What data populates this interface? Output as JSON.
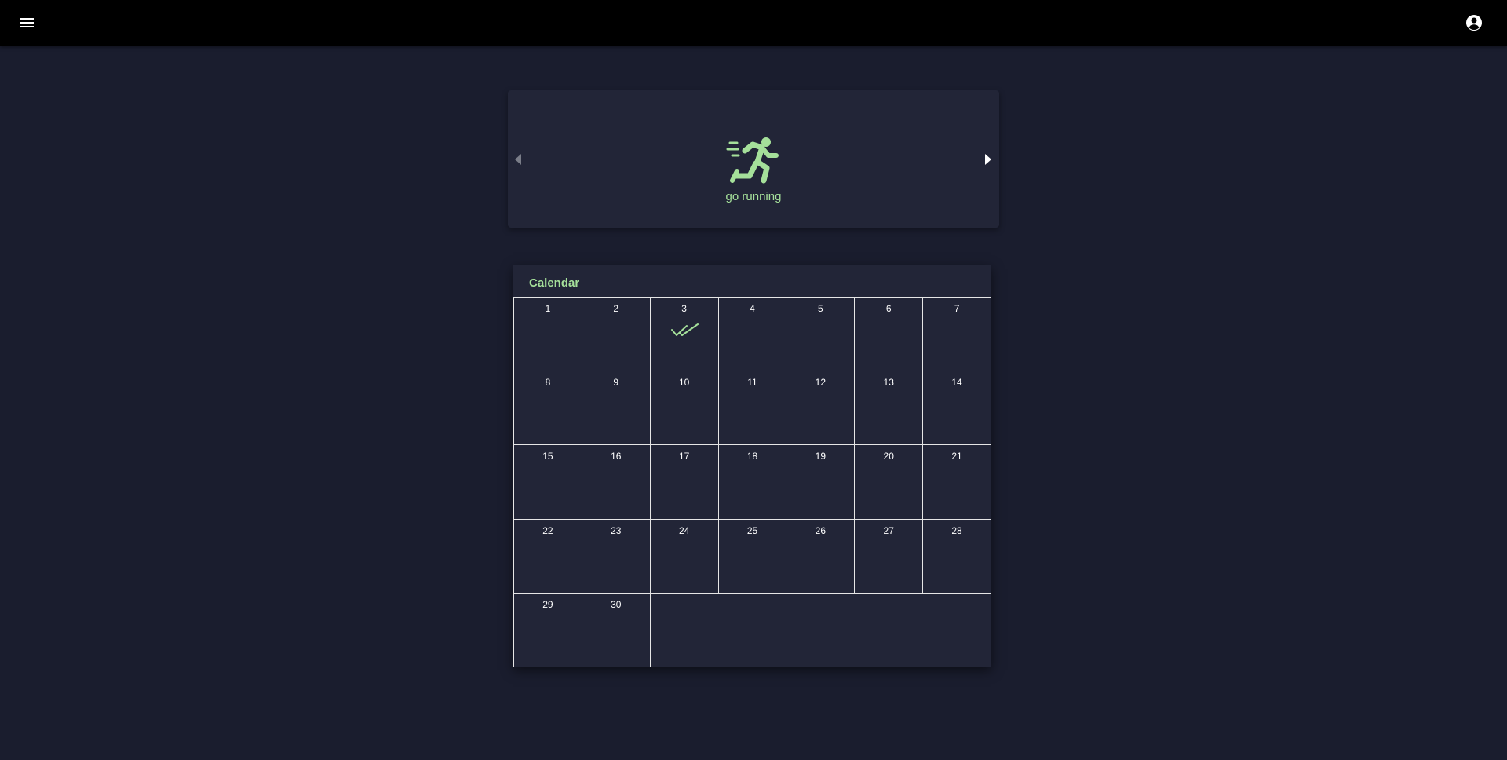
{
  "topbar": {
    "menu_icon": "hamburger-menu-icon",
    "account_icon": "account-circle-icon"
  },
  "habit_carousel": {
    "habit_name": "go running",
    "icon": "running-person-icon",
    "prev_icon": "triangle-left-icon",
    "next_icon": "triangle-right-icon",
    "accent_color": "#a5e09a"
  },
  "calendar": {
    "title": "Calendar",
    "days": [
      {
        "label": "1",
        "done": false
      },
      {
        "label": "2",
        "done": false
      },
      {
        "label": "3",
        "done": true
      },
      {
        "label": "4",
        "done": false
      },
      {
        "label": "5",
        "done": false
      },
      {
        "label": "6",
        "done": false
      },
      {
        "label": "7",
        "done": false
      },
      {
        "label": "8",
        "done": false
      },
      {
        "label": "9",
        "done": false
      },
      {
        "label": "10",
        "done": false
      },
      {
        "label": "11",
        "done": false
      },
      {
        "label": "12",
        "done": false
      },
      {
        "label": "13",
        "done": false
      },
      {
        "label": "14",
        "done": false
      },
      {
        "label": "15",
        "done": false
      },
      {
        "label": "16",
        "done": false
      },
      {
        "label": "17",
        "done": false
      },
      {
        "label": "18",
        "done": false
      },
      {
        "label": "19",
        "done": false
      },
      {
        "label": "20",
        "done": false
      },
      {
        "label": "21",
        "done": false
      },
      {
        "label": "22",
        "done": false
      },
      {
        "label": "23",
        "done": false
      },
      {
        "label": "24",
        "done": false
      },
      {
        "label": "25",
        "done": false
      },
      {
        "label": "26",
        "done": false
      },
      {
        "label": "27",
        "done": false
      },
      {
        "label": "28",
        "done": false
      },
      {
        "label": "29",
        "done": false
      },
      {
        "label": "30",
        "done": false
      }
    ],
    "done_icon": "double-check-icon"
  }
}
